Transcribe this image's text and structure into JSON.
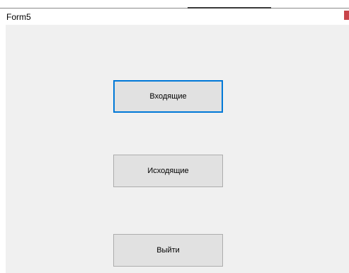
{
  "window": {
    "title": "Form5"
  },
  "buttons": {
    "incoming_label": "Входящие",
    "outgoing_label": "Исходящие",
    "exit_label": "Выйти"
  },
  "colors": {
    "client_background": "#f0f0f0",
    "button_background": "#e1e1e1",
    "button_border": "#adadad",
    "focus_border": "#0078d7",
    "title_accent": "#c8444a"
  }
}
